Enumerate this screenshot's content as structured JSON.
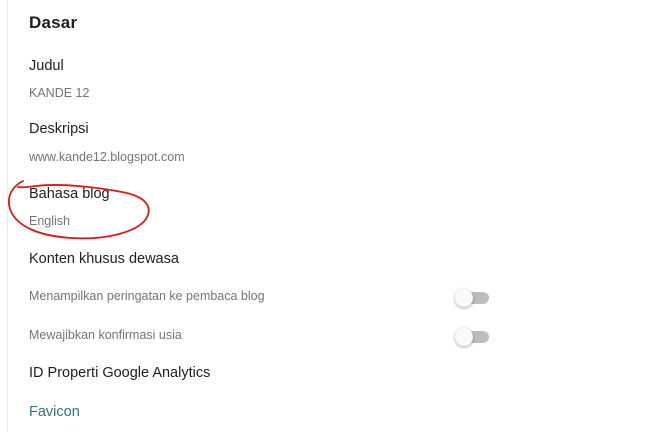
{
  "section": {
    "title": "Dasar"
  },
  "settings": {
    "title": {
      "label": "Judul",
      "value": "KANDE 12"
    },
    "description": {
      "label": "Deskripsi",
      "value": "www.kande12.blogspot.com"
    },
    "language": {
      "label": "Bahasa blog",
      "value": "English"
    },
    "adult": {
      "label": "Konten khusus dewasa",
      "options": [
        {
          "label": "Menampilkan peringatan ke pembaca blog",
          "enabled": false
        },
        {
          "label": "Mewajibkan konfirmasi usia",
          "enabled": false
        }
      ]
    },
    "analytics": {
      "label": "ID Properti Google Analytics"
    },
    "favicon": {
      "label": "Favicon"
    }
  },
  "colors": {
    "link": "#2b7a83",
    "annotation": "#e0161b",
    "toggle_off": "#bdbdbd"
  }
}
